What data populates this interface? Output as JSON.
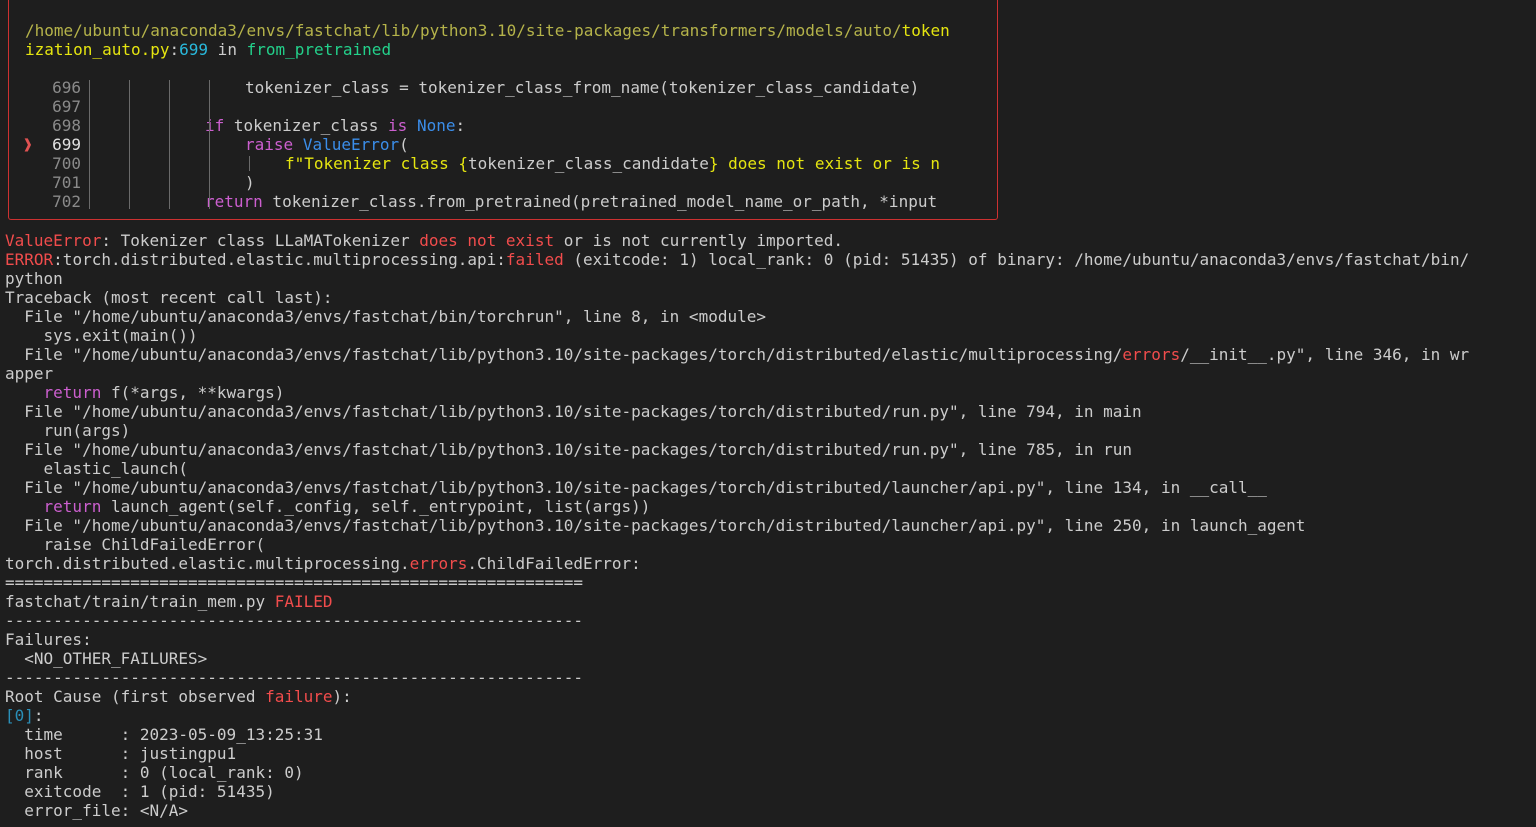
{
  "colors": {
    "background": "#1e1e1e",
    "foreground": "#cccccc",
    "box_border": "#cd3131",
    "error_red": "#f14c4c",
    "path_yellow": "#b5b34a",
    "keyword_purple": "#cc5fcf",
    "keyword_blue": "#3b8eea",
    "string_yellow": "#e5e510",
    "function_green": "#23d18b",
    "number_cyan": "#29b8db"
  },
  "rich_box": {
    "file_path_1": "/home/ubuntu/anaconda3/envs/fastchat/lib/python3.10/site-packages/transformers/models/auto/",
    "file_path_hl": "token",
    "file_path_2": "ization_auto.py",
    "colon": ":",
    "line_no": "699",
    "in_word": " in ",
    "func_name": "from_pretrained",
    "arrow": "❱",
    "code_lines": [
      {
        "num": "696",
        "segments": [
          {
            "t": "tokenizer_class = tokenizer_class_from_name(tokenizer_class_candidate)",
            "c": ""
          }
        ]
      },
      {
        "num": "697",
        "segments": []
      },
      {
        "num": "698",
        "segments": [
          {
            "t": "if",
            "c": "c-kw"
          },
          {
            "t": " tokenizer_class ",
            "c": ""
          },
          {
            "t": "is",
            "c": "c-kw"
          },
          {
            "t": " ",
            "c": ""
          },
          {
            "t": "None",
            "c": "c-const"
          },
          {
            "t": ":",
            "c": ""
          }
        ]
      },
      {
        "num": "699",
        "segments": [
          {
            "t": "raise",
            "c": "c-kw"
          },
          {
            "t": " ",
            "c": ""
          },
          {
            "t": "ValueError",
            "c": "c-blue"
          },
          {
            "t": "(",
            "c": ""
          }
        ]
      },
      {
        "num": "700",
        "segments": [
          {
            "t": "f\"Tokenizer class {",
            "c": "c-str"
          },
          {
            "t": "tokenizer_class_candidate",
            "c": ""
          },
          {
            "t": "} does not exist or is n",
            "c": "c-str"
          }
        ]
      },
      {
        "num": "701",
        "segments": [
          {
            "t": ")",
            "c": ""
          }
        ]
      },
      {
        "num": "702",
        "segments": [
          {
            "t": "return",
            "c": "c-kw"
          },
          {
            "t": " tokenizer_class.from_pretrained(pretrained_model_name_or_path, *input",
            "c": ""
          }
        ]
      }
    ]
  },
  "output_lines": [
    [
      {
        "t": "ValueError",
        "c": "c-err"
      },
      {
        "t": ": Tokenizer class LLaMATokenizer ",
        "c": ""
      },
      {
        "t": "does not exist",
        "c": "c-err"
      },
      {
        "t": " or is not currently imported.",
        "c": ""
      }
    ],
    [
      {
        "t": "ERROR",
        "c": "c-err"
      },
      {
        "t": ":torch.distributed.elastic.multiprocessing.api:",
        "c": ""
      },
      {
        "t": "failed",
        "c": "c-err"
      },
      {
        "t": " (exitcode: 1) local_rank: 0 (pid: 51435) of binary: /home/ubuntu/anaconda3/envs/fastchat/bin/",
        "c": ""
      }
    ],
    [
      {
        "t": "python",
        "c": ""
      }
    ],
    [
      {
        "t": "Traceback (most recent call last):",
        "c": ""
      }
    ],
    [
      {
        "t": "  File \"/home/ubuntu/anaconda3/envs/fastchat/bin/torchrun\", line 8, in <module>",
        "c": ""
      }
    ],
    [
      {
        "t": "    sys.exit(main())",
        "c": ""
      }
    ],
    [
      {
        "t": "  File \"/home/ubuntu/anaconda3/envs/fastchat/lib/python3.10/site-packages/torch/distributed/elastic/multiprocessing/",
        "c": ""
      },
      {
        "t": "errors",
        "c": "c-err"
      },
      {
        "t": "/__init__.py\", line 346, in wr",
        "c": ""
      }
    ],
    [
      {
        "t": "apper",
        "c": ""
      }
    ],
    [
      {
        "t": "    ",
        "c": ""
      },
      {
        "t": "return",
        "c": "c-kw"
      },
      {
        "t": " f(*args, **kwargs)",
        "c": ""
      }
    ],
    [
      {
        "t": "  File \"/home/ubuntu/anaconda3/envs/fastchat/lib/python3.10/site-packages/torch/distributed/run.py\", line 794, in main",
        "c": ""
      }
    ],
    [
      {
        "t": "    run(args)",
        "c": ""
      }
    ],
    [
      {
        "t": "  File \"/home/ubuntu/anaconda3/envs/fastchat/lib/python3.10/site-packages/torch/distributed/run.py\", line 785, in run",
        "c": ""
      }
    ],
    [
      {
        "t": "    elastic_launch(",
        "c": ""
      }
    ],
    [
      {
        "t": "  File \"/home/ubuntu/anaconda3/envs/fastchat/lib/python3.10/site-packages/torch/distributed/launcher/api.py\", line 134, in __call__",
        "c": ""
      }
    ],
    [
      {
        "t": "    ",
        "c": ""
      },
      {
        "t": "return",
        "c": "c-kw"
      },
      {
        "t": " launch_agent(self._config, self._entrypoint, list(args))",
        "c": ""
      }
    ],
    [
      {
        "t": "  File \"/home/ubuntu/anaconda3/envs/fastchat/lib/python3.10/site-packages/torch/distributed/launcher/api.py\", line 250, in launch_agent",
        "c": ""
      }
    ],
    [
      {
        "t": "    raise ChildFailedError(",
        "c": ""
      }
    ],
    [
      {
        "t": "torch.distributed.elastic.multiprocessing.",
        "c": ""
      },
      {
        "t": "errors",
        "c": "c-err"
      },
      {
        "t": ".ChildFailedError:",
        "c": ""
      }
    ],
    [
      {
        "t": "============================================================",
        "c": ""
      }
    ],
    [
      {
        "t": "fastchat/train/train_mem.py ",
        "c": ""
      },
      {
        "t": "FAILED",
        "c": "c-err"
      }
    ],
    [
      {
        "t": "------------------------------------------------------------",
        "c": ""
      }
    ],
    [
      {
        "t": "Failures:",
        "c": ""
      }
    ],
    [
      {
        "t": "  <NO_OTHER_FAILURES>",
        "c": ""
      }
    ],
    [
      {
        "t": "------------------------------------------------------------",
        "c": ""
      }
    ],
    [
      {
        "t": "Root Cause (first observed ",
        "c": ""
      },
      {
        "t": "failure",
        "c": "c-err"
      },
      {
        "t": "):",
        "c": ""
      }
    ],
    [
      {
        "t": "[0]",
        "c": "c-idx"
      },
      {
        "t": ":",
        "c": ""
      }
    ],
    [
      {
        "t": "  time      : 2023-05-09_13:25:31",
        "c": ""
      }
    ],
    [
      {
        "t": "  host      : justingpu1",
        "c": ""
      }
    ],
    [
      {
        "t": "  rank      : 0 (local_rank: 0)",
        "c": ""
      }
    ],
    [
      {
        "t": "  exitcode  : 1 (pid: 51435)",
        "c": ""
      }
    ],
    [
      {
        "t": "  error_file: <N/A>",
        "c": ""
      }
    ]
  ]
}
